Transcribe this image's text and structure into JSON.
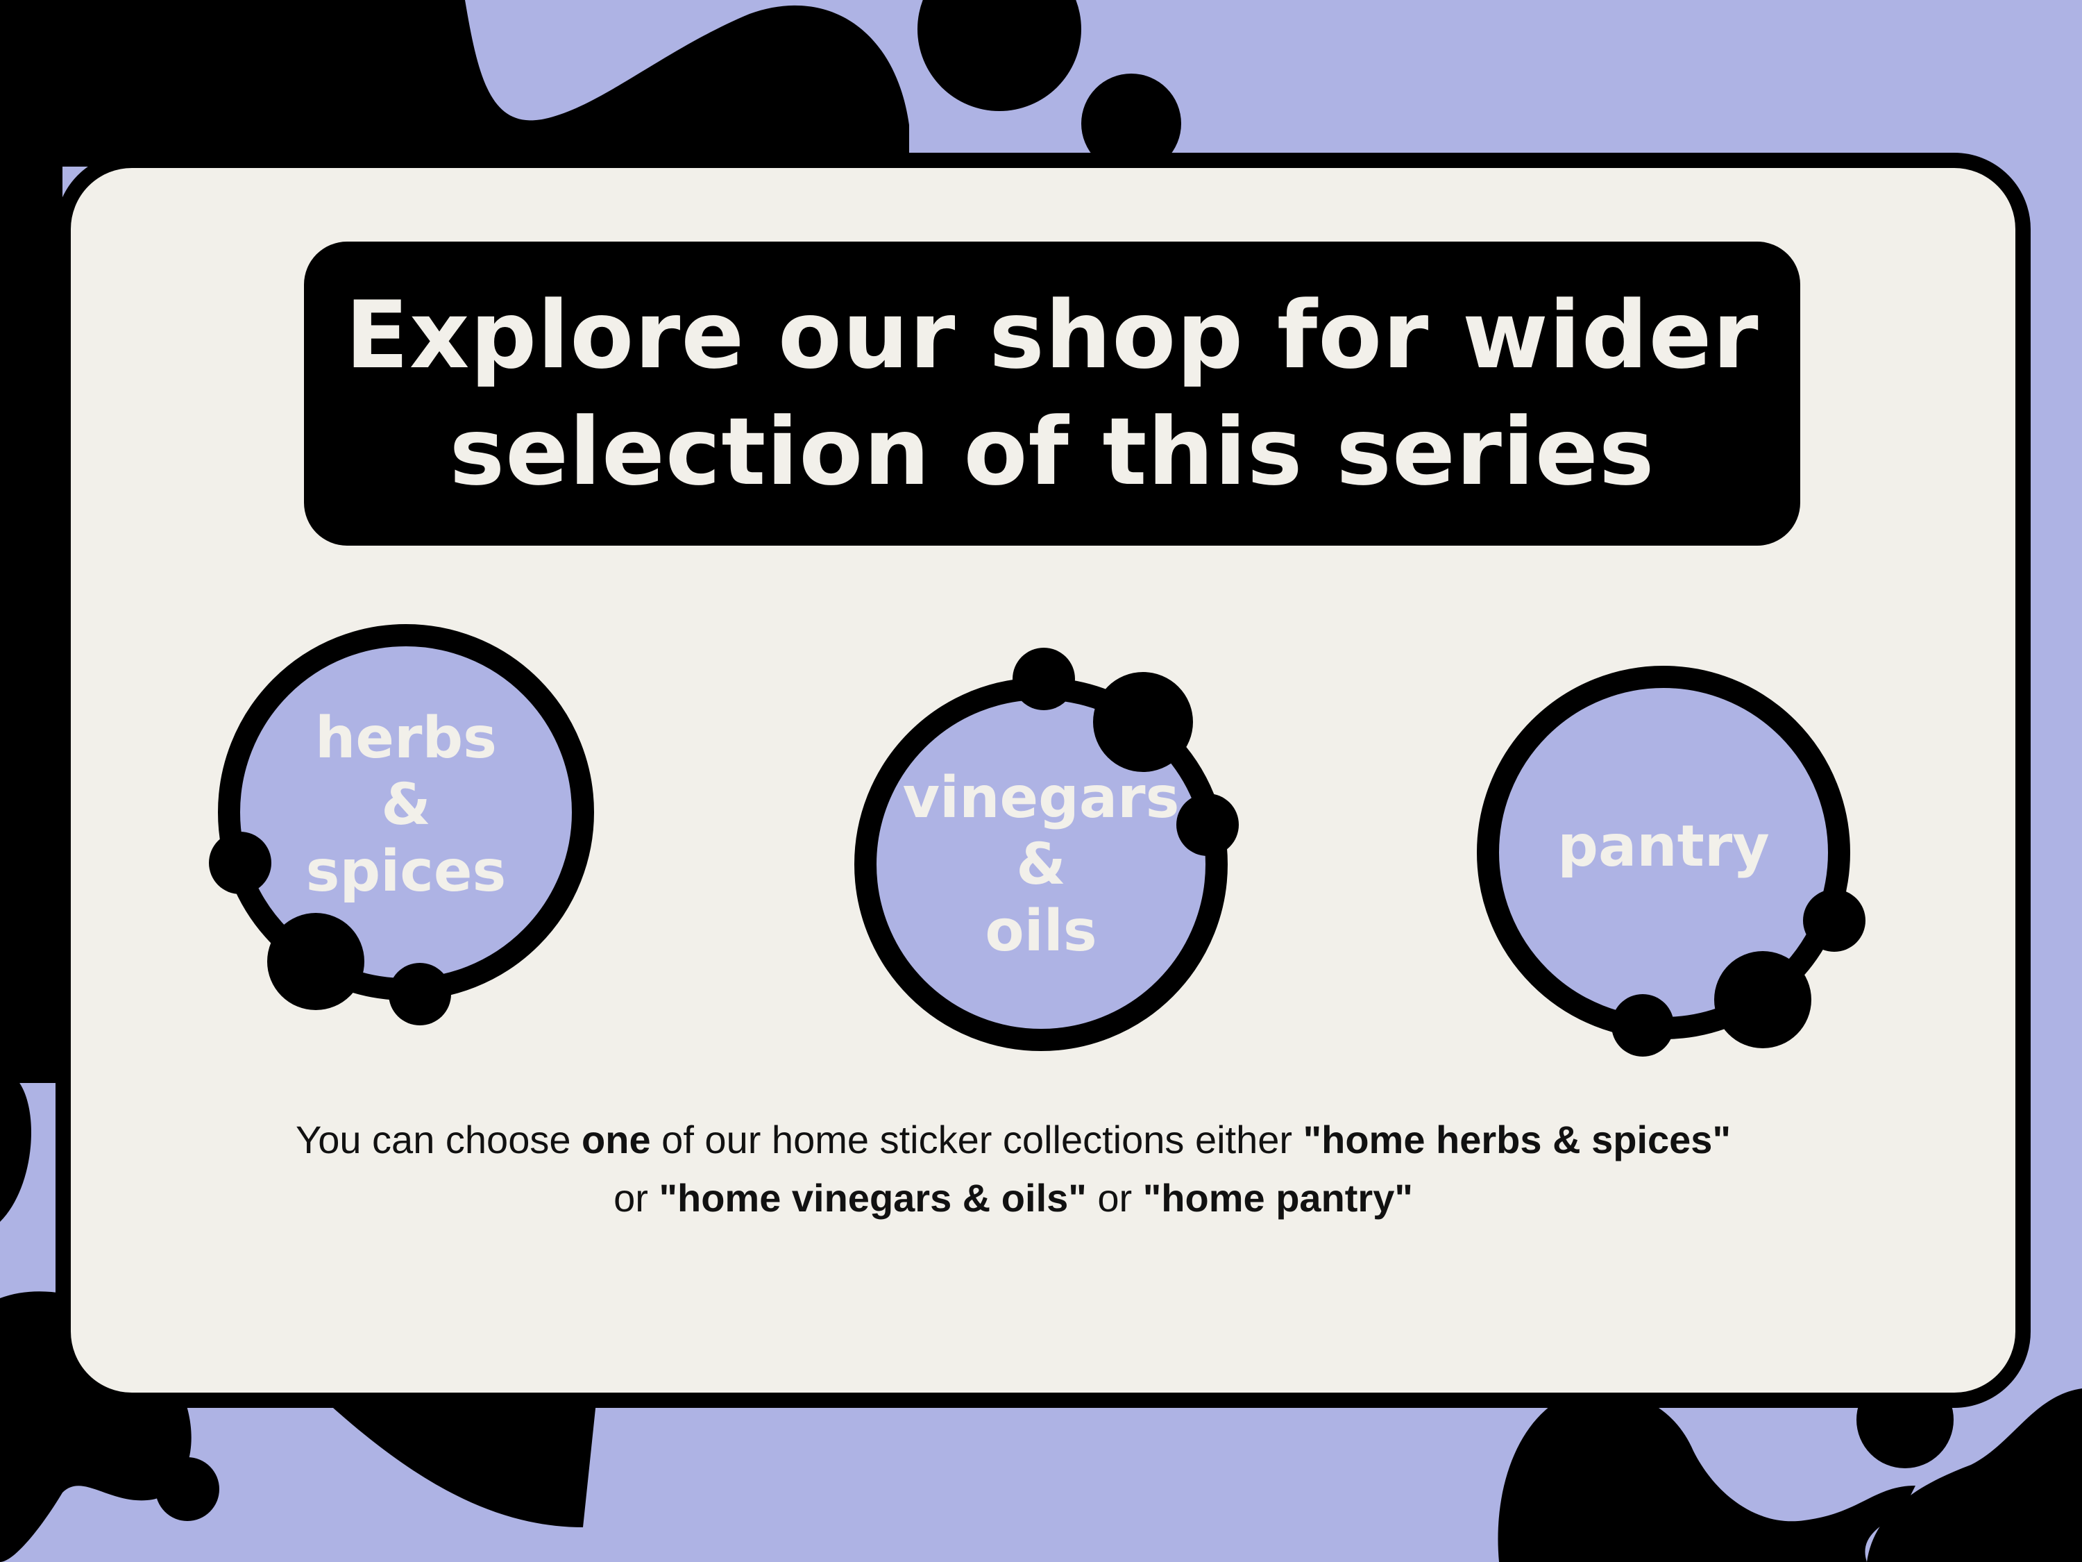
{
  "colors": {
    "background": "#aeb3e4",
    "card": "#f2f0ea",
    "ink": "#000000",
    "circle_fill": "#aeb3e4",
    "label_text": "#f2f0ea"
  },
  "banner": {
    "title": "Explore our shop for wider\nselection of this series"
  },
  "collections": [
    {
      "label": "herbs\n&\nspices",
      "icon": "circle-badge"
    },
    {
      "label": "vinegars\n&\noils",
      "icon": "circle-badge"
    },
    {
      "label": "pantry",
      "icon": "circle-badge"
    }
  ],
  "caption": {
    "line1_part1": "You can choose ",
    "line1_bold1": "one",
    "line1_part2": " of our home sticker collections either ",
    "line1_bold2": "\"home herbs & spices\"",
    "line2_part1": "or ",
    "line2_bold1": "\"home vinegars & oils\"",
    "line2_part2": " or ",
    "line2_bold2": "\"home pantry\""
  }
}
